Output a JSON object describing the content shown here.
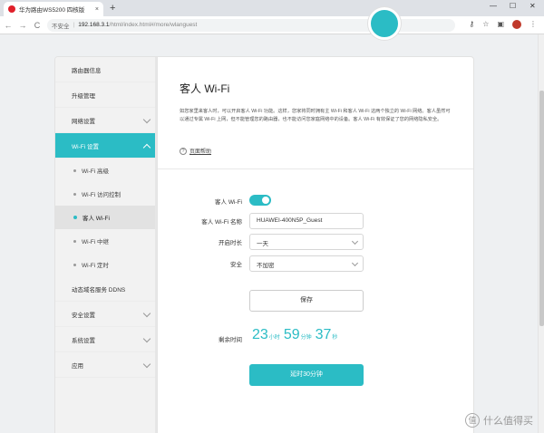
{
  "browser": {
    "tab_title": "华为路由WS5200 四核版",
    "tab_close": "×",
    "new_tab": "+",
    "url_insecure": "不安全",
    "url_separator": "|",
    "url_host": "192.168.3.1",
    "url_path": "/html/index.html#/more/wlanguest",
    "win_min": "—",
    "win_max": "☐",
    "win_close": "✕",
    "nav_back": "←",
    "nav_forward": "→",
    "nav_reload": "C"
  },
  "sidebar": {
    "items": [
      {
        "label": "路由器信息"
      },
      {
        "label": "升级管理"
      },
      {
        "label": "网络设置"
      },
      {
        "label": "Wi-Fi 设置"
      }
    ],
    "sub_items": [
      {
        "label": "Wi-Fi 高级"
      },
      {
        "label": "Wi-Fi 访问控制"
      },
      {
        "label": "客人 Wi-Fi"
      },
      {
        "label": "Wi-Fi 中继"
      },
      {
        "label": "Wi-Fi 定时"
      }
    ],
    "items_after": [
      {
        "label": "动态域名服务 DDNS"
      },
      {
        "label": "安全设置"
      },
      {
        "label": "系统设置"
      },
      {
        "label": "应用"
      }
    ]
  },
  "content": {
    "title": "客人 Wi-Fi",
    "description": "如您家里来客人时，可以开启客人 Wi-Fi 功能。这样，您家将同时拥有主 Wi-Fi 和客人 Wi-Fi 这两个独立的 Wi-Fi 网络。客人虽然可以通过专属 Wi-Fi 上网，但不能管理您的路由器，也不能访问您家庭网络中的设备。客人 Wi-Fi 有效保证了您的网络隐私安全。",
    "help_icon": "?",
    "help_link": "页面帮助",
    "form": {
      "guest_wifi_label": "客人 Wi-Fi",
      "guest_wifi_enabled": true,
      "name_label": "客人 Wi-Fi 名称",
      "name_value": "HUAWEI-400N5P_Guest",
      "duration_label": "开启时长",
      "duration_value": "一天",
      "security_label": "安全",
      "security_value": "不加密"
    },
    "save_button": "保存",
    "remaining_label": "剩余时间",
    "timer": {
      "hours": "23",
      "hours_unit": "小时",
      "minutes": "59",
      "minutes_unit": "分钟",
      "seconds": "37",
      "seconds_unit": "秒"
    },
    "extend_button": "延时30分钟"
  },
  "watermark": {
    "logo": "值",
    "text": "什么值得买"
  },
  "colors": {
    "accent": "#2bbcc5"
  }
}
